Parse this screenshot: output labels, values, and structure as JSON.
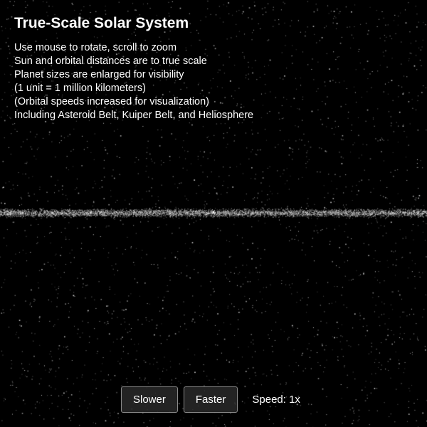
{
  "info": {
    "title": "True-Scale Solar System",
    "lines": [
      "Use mouse to rotate, scroll to zoom",
      "Sun and orbital distances are to true scale",
      "Planet sizes are enlarged for visibility",
      "(1 unit = 1 million kilometers)",
      "(Orbital speeds increased for visualization)",
      "Including Asteroid Belt, Kuiper Belt, and Heliosphere"
    ]
  },
  "controls": {
    "slower_label": "Slower",
    "faster_label": "Faster",
    "speed_text": "Speed: 1x"
  },
  "colors": {
    "background": "#000000",
    "text": "#ffffff",
    "button_border": "#8a8a8a"
  }
}
